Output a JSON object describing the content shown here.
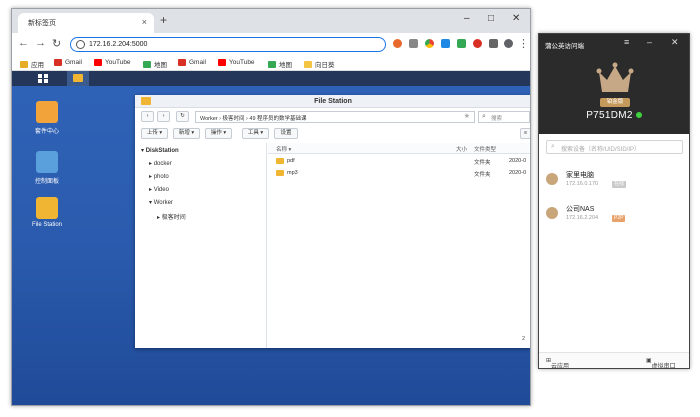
{
  "browser": {
    "tab_title": "新标签页",
    "tab_close": "×",
    "new_tab": "+",
    "minimize": "–",
    "maximize": "□",
    "close": "✕",
    "url": "172.16.2.204:5000",
    "bookmarks": [
      {
        "label": "应用",
        "color": "#e8ab25"
      },
      {
        "label": "Gmail",
        "color": "#d93025"
      },
      {
        "label": "YouTube",
        "color": "#ff0000"
      },
      {
        "label": "地图",
        "color": "#34a853"
      },
      {
        "label": "Gmail",
        "color": "#d93025"
      },
      {
        "label": "YouTube",
        "color": "#ff0000"
      },
      {
        "label": "地图",
        "color": "#34a853"
      },
      {
        "label": "向日葵",
        "color": "#f4c542"
      }
    ]
  },
  "dsm": {
    "desktop_icons": [
      {
        "label": "套件中心",
        "color": "#f2a43a"
      },
      {
        "label": "控制面板",
        "color": "#5aa0dd"
      },
      {
        "label": "File Station",
        "color": "#f0b633"
      }
    ],
    "file_station": {
      "title": "File Station",
      "path": "Worker  ›  极客时间  ›  49 程序员的数学基础课",
      "search_placeholder": "搜索",
      "buttons": [
        "上传 ▾",
        "新增 ▾",
        "操作 ▾",
        "工具 ▾",
        "设置"
      ],
      "tree": {
        "root": "DiskStation",
        "items": [
          "docker",
          "photo",
          "Video",
          "Worker"
        ],
        "sub_item": "极客时间"
      },
      "columns": {
        "name": "名称 ▾",
        "size": "大小",
        "type": "文件类型"
      },
      "rows": [
        {
          "name": "pdf",
          "type": "文件夹",
          "date": "2020-0"
        },
        {
          "name": "mp3",
          "type": "文件夹",
          "date": "2020-0"
        }
      ],
      "item_count": "2"
    }
  },
  "vpn_app": {
    "title": "蒲公英访问端",
    "badge": "铂金版",
    "device_name": "P751DM2",
    "search_placeholder": "搜索设备（名称/UID/SID/IP）",
    "devices": [
      {
        "name": "家里电脑",
        "ip": "172.16.0.170",
        "tag": "在线",
        "tag_color": "#c9c9c9"
      },
      {
        "name": "公司NAS",
        "ip": "172.16.2.204",
        "tag": "P2P",
        "tag_color": "#e8a26b"
      }
    ],
    "footer_left": "云应用",
    "footer_right": "虚拟串口"
  },
  "colors": {
    "accent": "#1a73e8",
    "desktop": "#2e5cb0",
    "online": "#3fd13f"
  }
}
